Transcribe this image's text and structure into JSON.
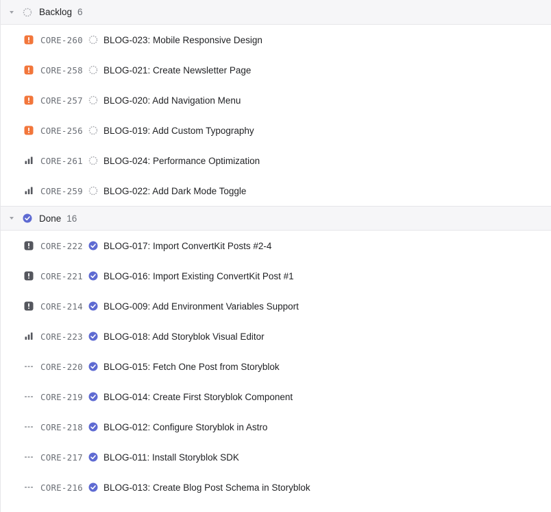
{
  "colors": {
    "urgent": "#f2763b",
    "high": "#55575e",
    "done": "#5e6ad2",
    "backlog": "#a0a2a8",
    "muted": "#6b6f76"
  },
  "groups": [
    {
      "title": "Backlog",
      "count": "6",
      "status_icon": "backlog-status-icon",
      "issues": [
        {
          "priority": "urgent",
          "id": "CORE-260",
          "title": "BLOG-023: Mobile Responsive Design"
        },
        {
          "priority": "urgent",
          "id": "CORE-258",
          "title": "BLOG-021: Create Newsletter Page"
        },
        {
          "priority": "urgent",
          "id": "CORE-257",
          "title": "BLOG-020: Add Navigation Menu"
        },
        {
          "priority": "urgent",
          "id": "CORE-256",
          "title": "BLOG-019: Add Custom Typography"
        },
        {
          "priority": "medium",
          "id": "CORE-261",
          "title": "BLOG-024: Performance Optimization"
        },
        {
          "priority": "medium",
          "id": "CORE-259",
          "title": "BLOG-022: Add Dark Mode Toggle"
        }
      ]
    },
    {
      "title": "Done",
      "count": "16",
      "status_icon": "done-status-icon",
      "issues": [
        {
          "priority": "high",
          "id": "CORE-222",
          "title": "BLOG-017: Import ConvertKit Posts #2-4"
        },
        {
          "priority": "high",
          "id": "CORE-221",
          "title": "BLOG-016: Import Existing ConvertKit Post #1"
        },
        {
          "priority": "high",
          "id": "CORE-214",
          "title": "BLOG-009: Add Environment Variables Support"
        },
        {
          "priority": "medium",
          "id": "CORE-223",
          "title": "BLOG-018: Add Storyblok Visual Editor"
        },
        {
          "priority": "none",
          "id": "CORE-220",
          "title": "BLOG-015: Fetch One Post from Storyblok"
        },
        {
          "priority": "none",
          "id": "CORE-219",
          "title": "BLOG-014: Create First Storyblok Component"
        },
        {
          "priority": "none",
          "id": "CORE-218",
          "title": "BLOG-012: Configure Storyblok in Astro"
        },
        {
          "priority": "none",
          "id": "CORE-217",
          "title": "BLOG-011: Install Storyblok SDK"
        },
        {
          "priority": "none",
          "id": "CORE-216",
          "title": "BLOG-013: Create Blog Post Schema in Storyblok"
        }
      ]
    }
  ]
}
